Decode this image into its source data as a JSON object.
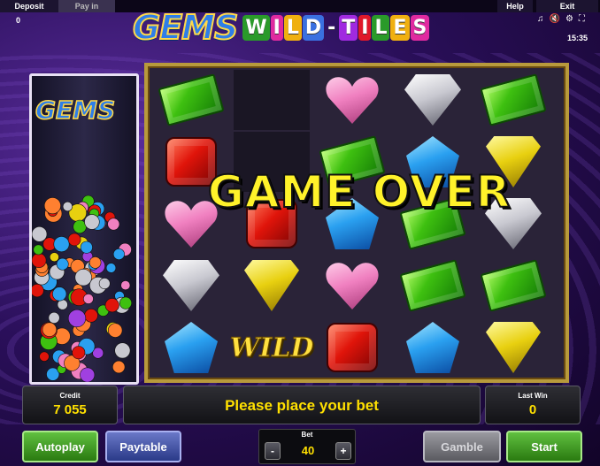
{
  "topbar": {
    "deposit": "Deposit",
    "payin": "Pay in",
    "help": "Help",
    "exit": "Exit"
  },
  "balance": "0",
  "clock": "15:35",
  "status_icons": [
    "music-icon",
    "sound-off-icon",
    "settings-icon",
    "fullscreen-icon"
  ],
  "logo": {
    "gems": "GEMS",
    "wild_tiles": [
      "W",
      "I",
      "L",
      "D",
      "-",
      "T",
      "I",
      "L",
      "E",
      "S"
    ],
    "tile_colors": [
      "#2a9a2a",
      "#e02aa0",
      "#f0b010",
      "#3a70e0",
      "#ffffff",
      "#a02ae0",
      "#e0182a",
      "#2a9a2a",
      "#f0b010",
      "#e02aa0"
    ]
  },
  "tube_logo": "GEMS",
  "reels": [
    [
      "emerald",
      "blank",
      "heart",
      "diamond",
      "emerald"
    ],
    [
      "ruby",
      "blank",
      "emerald",
      "sapphire",
      "topaz"
    ],
    [
      "heart",
      "ruby",
      "sapphire",
      "emerald",
      "diamond"
    ],
    [
      "diamond",
      "topaz",
      "heart",
      "emerald",
      "emerald"
    ],
    [
      "sapphire",
      "wild",
      "ruby",
      "sapphire",
      "topaz"
    ]
  ],
  "wild_label": "WILD",
  "overlay": "GAME OVER",
  "credit": {
    "label": "Credit",
    "value": "7 055"
  },
  "message": "Please place your bet",
  "lastwin": {
    "label": "Last Win",
    "value": "0"
  },
  "buttons": {
    "autoplay": "Autoplay",
    "paytable": "Paytable",
    "gamble": "Gamble",
    "start": "Start"
  },
  "bet": {
    "label": "Bet",
    "value": "40",
    "minus": "-",
    "plus": "+"
  }
}
